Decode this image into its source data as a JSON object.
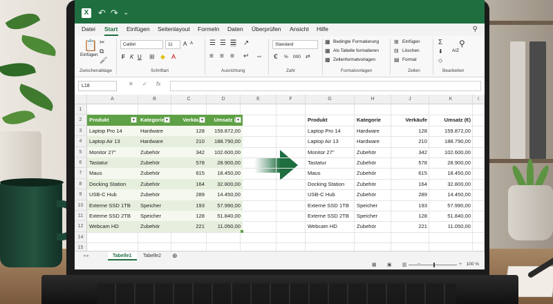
{
  "app": {
    "quick_access": [
      "↶",
      "↷",
      "⌄"
    ],
    "logo_letter": "X"
  },
  "menu": {
    "items": [
      "Datei",
      "Start",
      "Einfügen",
      "Seitenlayout",
      "Formeln",
      "Daten",
      "Überprüfen",
      "Ansicht",
      "Hilfe"
    ],
    "active": "Start"
  },
  "ribbon": {
    "clipboard": {
      "paste_label": "Einfügen",
      "group": "Zwischenablage"
    },
    "font": {
      "name": "Calibri",
      "size": "11",
      "group": "Schriftart",
      "bold": "F",
      "italic": "K",
      "underline": "U",
      "grow": "A",
      "shrink": "A"
    },
    "alignment": {
      "group": "Ausrichtung"
    },
    "number": {
      "format": "Standard",
      "group": "Zahl",
      "percent": "%",
      "thousands": "000"
    },
    "styles": {
      "conditional": "Bedingte Formatierung",
      "as_table": "Als Tabelle formatieren",
      "cell_styles": "Zellenformatvorlagen",
      "group": "Formatvorlagen"
    },
    "cells": {
      "insert": "Einfügen",
      "delete": "Löschen",
      "format": "Format",
      "group": "Zellen"
    },
    "editing": {
      "sigma": "Σ",
      "sort": "A/Z",
      "group": "Bearbeiten"
    }
  },
  "formula_bar": {
    "cell_ref": "L18",
    "cancel": "✕",
    "confirm": "✓",
    "fx": "fx",
    "content": ""
  },
  "grid": {
    "columns": [
      "A",
      "B",
      "C",
      "D",
      "E",
      "F",
      "G",
      "H",
      "J",
      "K",
      "I"
    ],
    "rows": [
      "1",
      "2",
      "3",
      "4",
      "5",
      "6",
      "7",
      "8",
      "9",
      "10",
      "11",
      "12",
      "14",
      "15"
    ]
  },
  "table": {
    "headers": [
      "Produkt",
      "Kategorie",
      "Verkäufe",
      "Umsatz (€)"
    ],
    "rows": [
      [
        "Laptop Pro 14",
        "Hardware",
        "128",
        "159.872,00"
      ],
      [
        "Laptop Air 13",
        "Hardware",
        "210",
        "188.790,00"
      ],
      [
        "Monitor 27\"",
        "Zubehör",
        "342",
        "102.600,00"
      ],
      [
        "Tastatur",
        "Zubehör",
        "578",
        "28.900,00"
      ],
      [
        "Maus",
        "Zubehör",
        "615",
        "18.450,00"
      ],
      [
        "Docking Station",
        "Zubehör",
        "164",
        "32.800,00"
      ],
      [
        "USB-C Hub",
        "Zubehör",
        "289",
        "14.450,00"
      ],
      [
        "Externe SSD 1TB",
        "Speicher",
        "193",
        "57.990,00"
      ],
      [
        "Externe SSD 2TB",
        "Speicher",
        "128",
        "51.840,00"
      ],
      [
        "Webcam HD",
        "Zubehör",
        "221",
        "11.050,00"
      ]
    ]
  },
  "sheets": {
    "tabs": [
      "Tabelle1",
      "Tabelle2"
    ],
    "active": "Tabelle1",
    "add": "⊕",
    "nav": "◂ ▸"
  },
  "status": {
    "zoom": "100 %",
    "minus": "−",
    "plus": "+"
  },
  "colors": {
    "excel_green": "#1e6e40",
    "table_header": "#5ea045",
    "band_light": "#f4f8ef",
    "band_dark": "#e6efdd"
  }
}
